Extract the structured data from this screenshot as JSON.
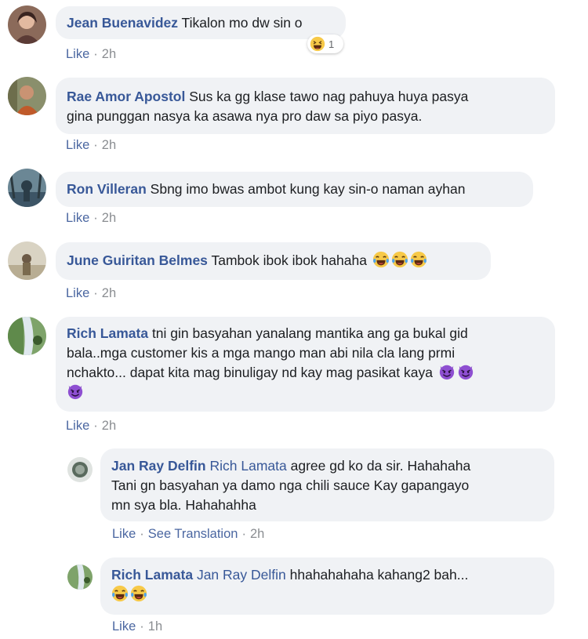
{
  "comments": [
    {
      "author": "Jean Buenavidez",
      "text": "Tikalon mo dw sin o",
      "reaction_count": "1",
      "reaction_icon": "laugh-emoji",
      "like": "Like",
      "time": "2h"
    },
    {
      "author": "Rae Amor Apostol",
      "text_line1": "Sus ka gg klase tawo nag pahuya huya pasya",
      "text_line2": "gina punggan nasya ka asawa nya pro daw sa piyo pasya.",
      "like": "Like",
      "time": "2h"
    },
    {
      "author": "Ron Villeran",
      "text": "Sbng imo bwas ambot kung kay sin-o naman ayhan",
      "like": "Like",
      "time": "2h"
    },
    {
      "author": "June Guiritan Belmes",
      "text": "Tambok ibok ibok hahaha",
      "emojis": [
        "tears-of-joy",
        "tears-of-joy",
        "tears-of-joy"
      ],
      "like": "Like",
      "time": "2h"
    },
    {
      "author": "Rich Lamata",
      "text_line1": "tni gin basyahan yanalang mantika ang ga bukal gid",
      "text_line2": "bala..mga customer kis a mga mango man abi nila cla lang prmi",
      "text_line3": "nchakto... dapat kita mag binuligay nd kay mag pasikat kaya",
      "emojis": [
        "smiling-imp",
        "smiling-imp",
        "smiling-imp"
      ],
      "like": "Like",
      "time": "2h"
    }
  ],
  "replies": [
    {
      "author": "Jan Ray Delfin",
      "mention": "Rich Lamata",
      "text_line1": "agree gd ko da sir. Hahahaha",
      "text_line2": "Tani gn basyahan ya damo nga chili sauce Kay gapangayo",
      "text_line3": "mn sya bla. Hahahahha",
      "like": "Like",
      "see_translation": "See Translation",
      "time": "2h"
    },
    {
      "author": "Rich Lamata",
      "mention": "Jan Ray Delfin",
      "text": "hhahahahaha kahang2 bah...",
      "emojis": [
        "tears-of-joy",
        "tears-of-joy"
      ],
      "like": "Like",
      "time": "1h"
    }
  ],
  "colors": {
    "bubble": "#f0f2f5",
    "name": "#385898",
    "meta": "#8a8d91"
  }
}
